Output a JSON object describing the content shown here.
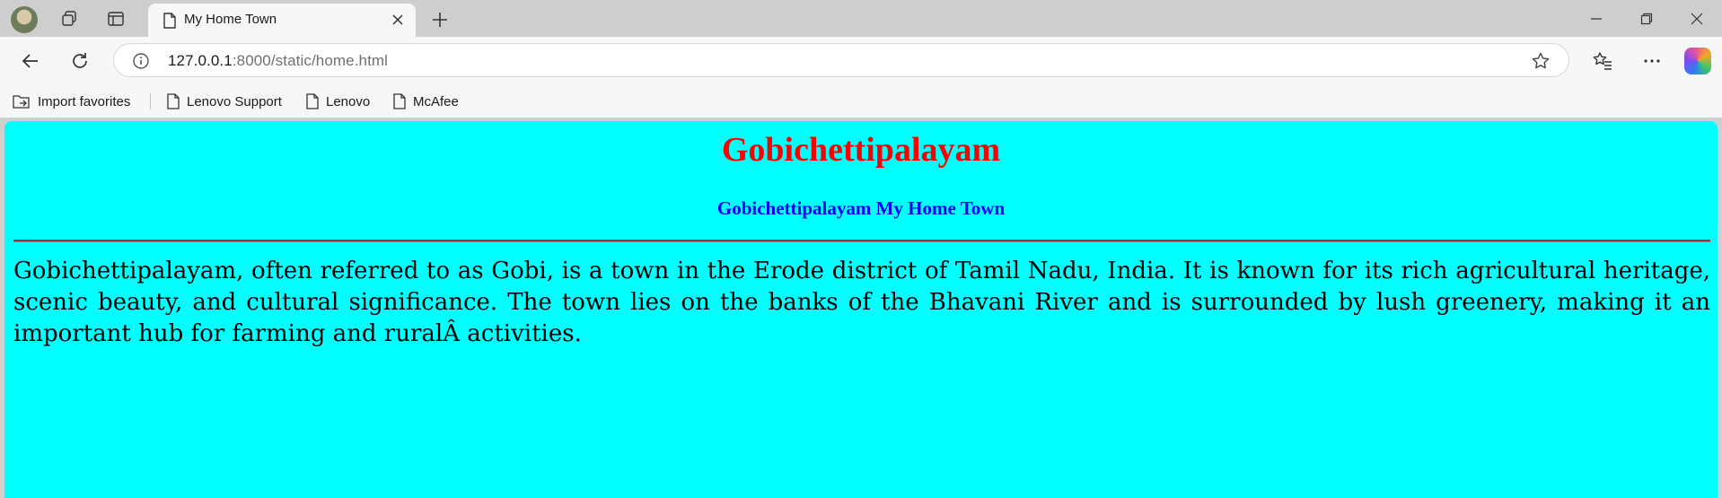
{
  "browser": {
    "tab": {
      "title": "My Home Town"
    },
    "address": {
      "host": "127.0.0.1",
      "rest": ":8000/static/home.html"
    },
    "favorites": [
      {
        "label": "Import favorites",
        "icon": "import-favorites-icon"
      },
      {
        "label": "Lenovo Support",
        "icon": "page-icon"
      },
      {
        "label": "Lenovo",
        "icon": "page-icon"
      },
      {
        "label": "McAfee",
        "icon": "page-icon"
      }
    ]
  },
  "page": {
    "heading": "Gobichettipalayam",
    "subheading": "Gobichettipalayam My Home Town",
    "paragraph": "Gobichettipalayam, often referred to as Gobi, is a town in the Erode district of Tamil Nadu, India. It is known for its rich agricultural heritage, scenic beauty, and cultural significance. The town lies on the banks of the Bhavani River and is surrounded by lush greenery, making it an important hub for farming and ruralÂ activities.",
    "background_color": "#00ffff",
    "heading_color": "#ff0000",
    "subheading_color": "#0000ff"
  }
}
